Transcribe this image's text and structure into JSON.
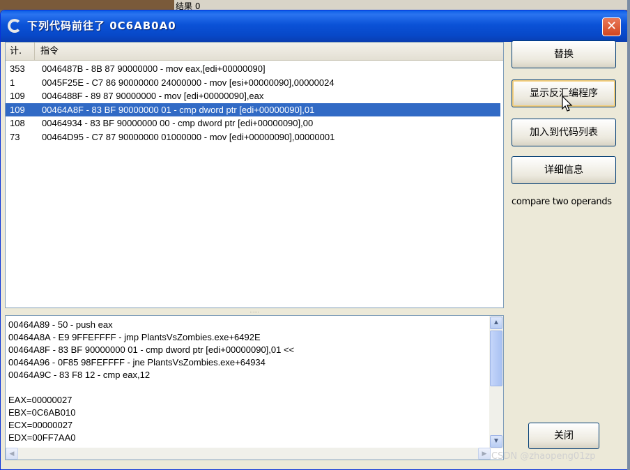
{
  "background": {
    "text": "结果 0"
  },
  "window": {
    "title": "下列代码前往了 0C6AB0A0",
    "close_glyph": "✕"
  },
  "list": {
    "headers": {
      "count": "计.",
      "instruction": "指令"
    },
    "rows": [
      {
        "count": "353",
        "instruction": "0046487B - 8B 87 90000000  - mov eax,[edi+00000090]"
      },
      {
        "count": "1",
        "instruction": "0045F25E - C7 86 90000000 24000000 - mov [esi+00000090],00000024"
      },
      {
        "count": "109",
        "instruction": "0046488F - 89 87 90000000  - mov [edi+00000090],eax"
      },
      {
        "count": "109",
        "instruction": "00464A8F - 83 BF 90000000 01 - cmp dword ptr [edi+00000090],01"
      },
      {
        "count": "108",
        "instruction": "00464934 - 83 BF 90000000 00 - cmp dword ptr [edi+00000090],00"
      },
      {
        "count": "73",
        "instruction": "00464D95 - C7 87 90000000 01000000 - mov [edi+00000090],00000001"
      }
    ],
    "selected_index": 3
  },
  "splitter": "......",
  "disasm": {
    "lines": [
      "00464A89 - 50 - push eax",
      "00464A8A - E9 9FFEFFFF - jmp PlantsVsZombies.exe+6492E",
      "00464A8F - 83 BF 90000000 01 - cmp dword ptr [edi+00000090],01 <<",
      "00464A96 - 0F85 98FEFFFF - jne PlantsVsZombies.exe+64934",
      "00464A9C - 83 F8 12 - cmp eax,12",
      "",
      "EAX=00000027",
      "EBX=0C6AB010",
      "ECX=00000027",
      "EDX=00FF7AA0"
    ]
  },
  "buttons": {
    "replace": "替换",
    "show_disassembler": "显示反汇编程序",
    "add_to_codelist": "加入到代码列表",
    "details": "详细信息",
    "close": "关闭"
  },
  "description": "compare two operands",
  "watermark": "CSDN @zhaopeng01zp",
  "icons": {
    "app": "cheat-engine-icon",
    "cursor": "mouse-pointer-icon",
    "scroll_up": "▲",
    "scroll_down": "▼",
    "scroll_left": "◀",
    "scroll_right": "▶"
  }
}
